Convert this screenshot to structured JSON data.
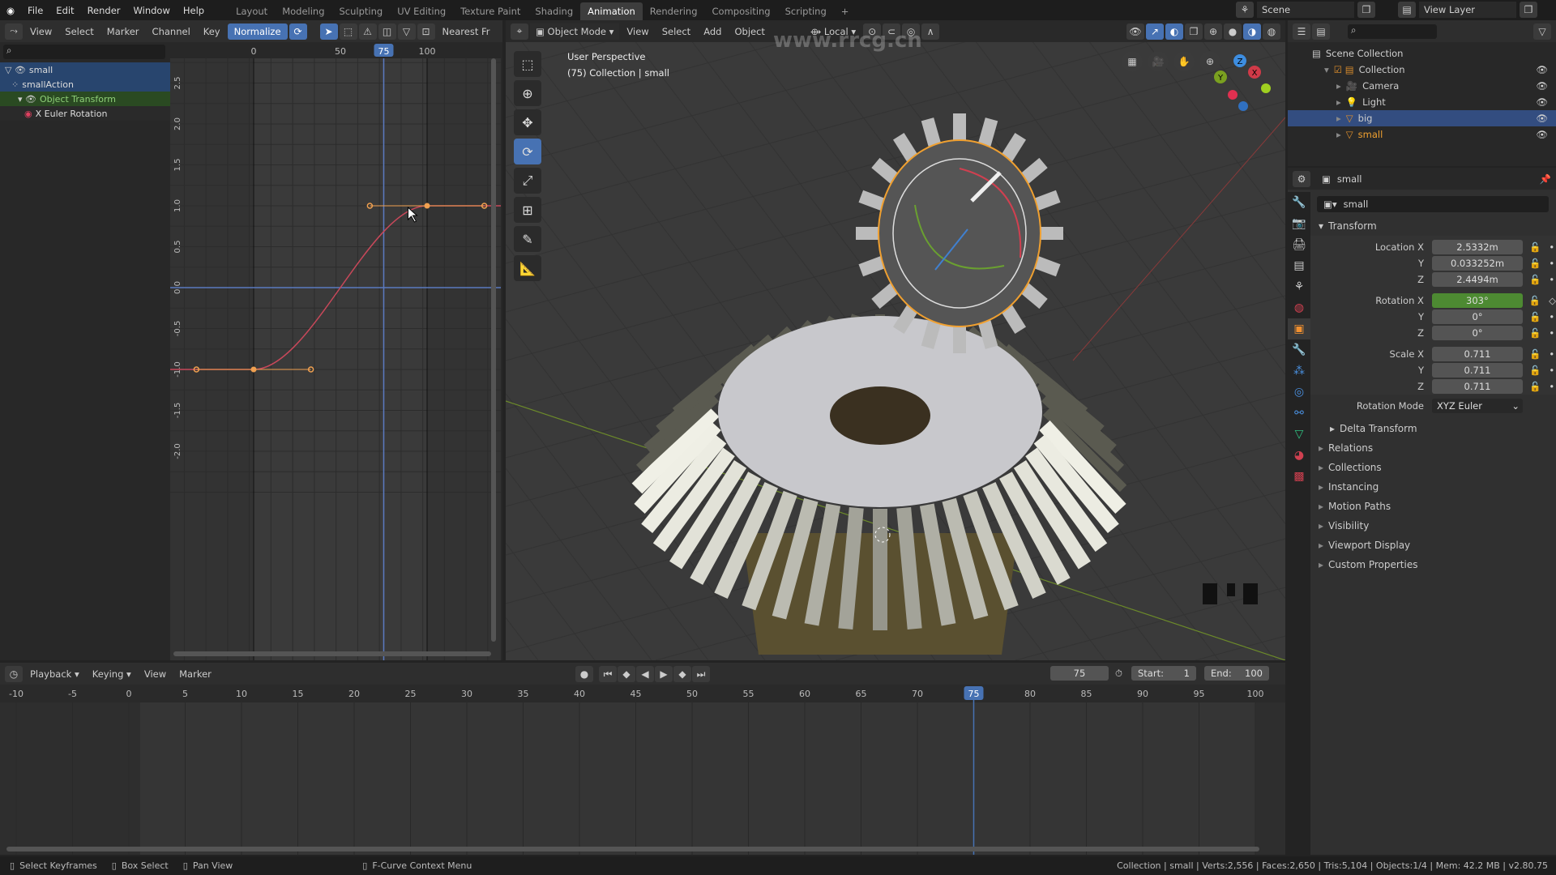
{
  "menu": [
    "File",
    "Edit",
    "Render",
    "Window",
    "Help"
  ],
  "workspaces": [
    "Layout",
    "Modeling",
    "Sculpting",
    "UV Editing",
    "Texture Paint",
    "Shading",
    "Animation",
    "Rendering",
    "Compositing",
    "Scripting"
  ],
  "active_workspace": "Animation",
  "scene": "Scene",
  "view_layer": "View Layer",
  "graph": {
    "menus": [
      "View",
      "Select",
      "Marker",
      "Channel",
      "Key"
    ],
    "normalize": "Normalize",
    "pivot": "Nearest Fr",
    "frame_labels": [
      "0",
      "50",
      "75",
      "100"
    ],
    "current_frame": "75",
    "value_labels": [
      "2.5",
      "2.0",
      "1.5",
      "1.0",
      "0.5",
      "0.0",
      "-0.5",
      "-1.0",
      "-1.5",
      "-2.0"
    ],
    "channels": [
      {
        "label": "small",
        "kind": "object"
      },
      {
        "label": "smallAction",
        "kind": "action"
      },
      {
        "label": "Object Transform",
        "kind": "group"
      },
      {
        "label": "X Euler Rotation",
        "kind": "fcurve"
      }
    ],
    "keyframes": [
      {
        "frame": 0,
        "value": -1.0
      },
      {
        "frame": 100,
        "value": 1.0
      }
    ],
    "curve_color": "#c8485a"
  },
  "viewport": {
    "mode": "Object Mode",
    "menus": [
      "View",
      "Select",
      "Add",
      "Object"
    ],
    "orientation": "Local",
    "title": "User Perspective",
    "subtitle": "(75) Collection | small"
  },
  "outliner": {
    "root": "Scene Collection",
    "items": [
      {
        "label": "Collection",
        "depth": 1
      },
      {
        "label": "Camera",
        "depth": 2
      },
      {
        "label": "Light",
        "depth": 2
      },
      {
        "label": "big",
        "depth": 2,
        "selected": true
      },
      {
        "label": "small",
        "depth": 2,
        "active": true
      }
    ]
  },
  "properties": {
    "object": "small",
    "datablock": "small",
    "transform_title": "Transform",
    "rows": [
      {
        "label": "Location X",
        "value": "2.5332m"
      },
      {
        "label": "Y",
        "value": "0.033252m"
      },
      {
        "label": "Z",
        "value": "2.4494m"
      },
      {
        "label": "Rotation X",
        "value": "303°",
        "keyed": true
      },
      {
        "label": "Y",
        "value": "0°"
      },
      {
        "label": "Z",
        "value": "0°"
      },
      {
        "label": "Scale X",
        "value": "0.711"
      },
      {
        "label": "Y",
        "value": "0.711"
      },
      {
        "label": "Z",
        "value": "0.711"
      }
    ],
    "rotation_mode_label": "Rotation Mode",
    "rotation_mode": "XYZ Euler",
    "delta": "Delta Transform",
    "panels": [
      "Relations",
      "Collections",
      "Instancing",
      "Motion Paths",
      "Visibility",
      "Viewport Display",
      "Custom Properties"
    ],
    "keyed_color": "#4d8a32"
  },
  "timeline": {
    "menus": [
      "Playback",
      "Keying",
      "View",
      "Marker"
    ],
    "current": "75",
    "start_label": "Start:",
    "start": "1",
    "end_label": "End:",
    "end": "100",
    "ticks": [
      "-10",
      "-5",
      "0",
      "5",
      "10",
      "15",
      "20",
      "25",
      "30",
      "35",
      "40",
      "45",
      "50",
      "55",
      "60",
      "65",
      "70",
      "75",
      "80",
      "85",
      "90",
      "95",
      "100"
    ]
  },
  "status": {
    "left": [
      "Select Keyframes",
      "Box Select",
      "Pan View",
      "F-Curve Context Menu"
    ],
    "right": "Collection | small | Verts:2,556 | Faces:2,650 | Tris:5,104 | Objects:1/4 | Mem: 42.2 MB | v2.80.75"
  },
  "watermark": "www.rrcg.cn"
}
